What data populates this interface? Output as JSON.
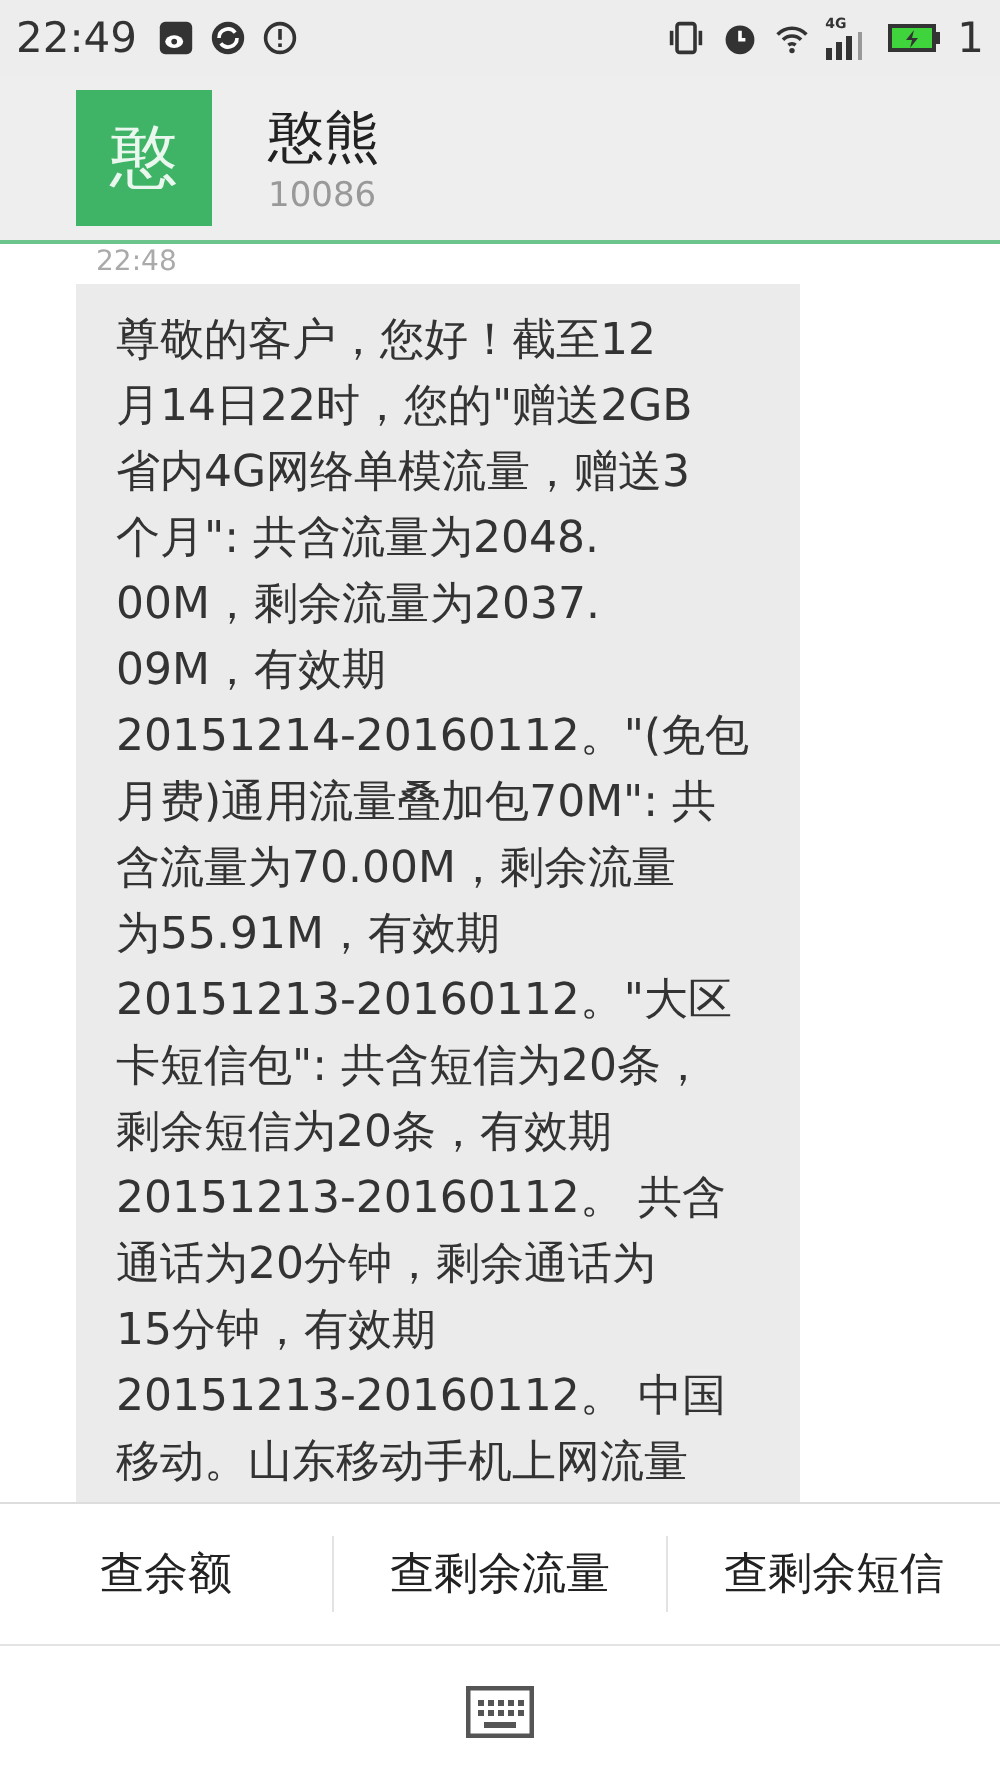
{
  "status_bar": {
    "time": "22:49",
    "network": "4G",
    "battery_text": "1"
  },
  "header": {
    "avatar_letter": "憨",
    "name": "憨熊",
    "number": "10086"
  },
  "messages": [
    {
      "time": "22:48",
      "lines": [
        "尊敬的客户，您好！截至12",
        "月14日22时，您的\"赠送2GB",
        "省内4G网络单模流量，赠送3",
        "个月\": 共含流量为2048.",
        "00M，剩余流量为2037.",
        "09M，有效期",
        "20151214-20160112。\"(免包",
        "月费)通用流量叠加包70M\": 共",
        "含流量为70.00M，剩余流量",
        "为55.91M，有效期",
        "20151213-20160112。\"大区",
        "卡短信包\": 共含短信为20条，",
        "剩余短信为20条，有效期",
        "20151213-20160112。 共含",
        "通话为20分钟，剩余通话为",
        "15分钟，有效期",
        "20151213-20160112。 中国",
        "移动。山东移动手机上网流量"
      ]
    }
  ],
  "quick_replies": [
    "查余额",
    "查剩余流量",
    "查剩余短信"
  ]
}
